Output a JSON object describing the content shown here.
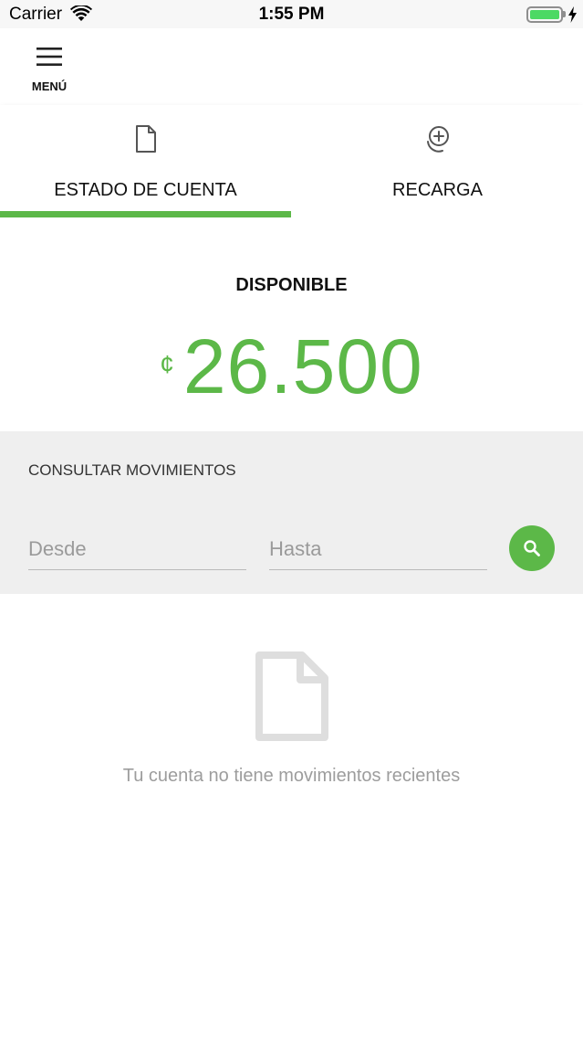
{
  "status_bar": {
    "carrier": "Carrier",
    "time": "1:55 PM",
    "battery_level": 1.0
  },
  "header": {
    "menu_label": "MENÚ",
    "menu_icon": "hamburger-icon"
  },
  "tabs": [
    {
      "label": "ESTADO DE CUENTA",
      "icon": "document-icon",
      "active": true
    },
    {
      "label": "RECARGA",
      "icon": "add-coin-icon",
      "active": false
    }
  ],
  "balance": {
    "label": "DISPONIBLE",
    "currency_symbol": "¢",
    "amount": "26.500"
  },
  "query": {
    "title": "CONSULTAR MOVIMIENTOS",
    "from_placeholder": "Desde",
    "to_placeholder": "Hasta",
    "search_icon": "search-icon"
  },
  "empty_state": {
    "icon": "document-icon",
    "message": "Tu cuenta no tiene movimientos recientes"
  },
  "colors": {
    "accent": "#5cb848",
    "battery": "#4cd964",
    "panel_bg": "#efefef",
    "muted_text": "#9d9d9d"
  }
}
